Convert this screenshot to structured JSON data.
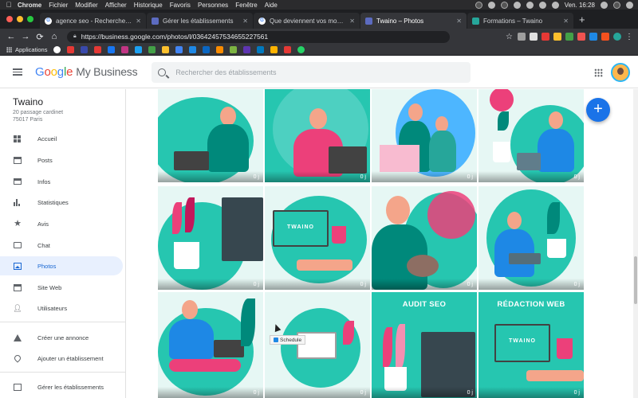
{
  "menubar": {
    "app": "Chrome",
    "items": [
      "Fichier",
      "Modifier",
      "Afficher",
      "Historique",
      "Favoris",
      "Personnes",
      "Fenêtre",
      "Aide"
    ],
    "clock": "Ven. 16:28"
  },
  "tabs": [
    {
      "title": "agence seo - Recherche Google",
      "favicon": "google-icon"
    },
    {
      "title": "Gérer les établissements",
      "favicon": "gmb-icon"
    },
    {
      "title": "Que deviennent vos modificatio",
      "favicon": "google-icon"
    },
    {
      "title": "Twaino – Photos",
      "favicon": "gmb-icon",
      "active": true
    },
    {
      "title": "Formations – Twaino",
      "favicon": "twaino-icon"
    }
  ],
  "toolbar": {
    "url": "https://business.google.com/photos/l/03642457534655227561"
  },
  "bookmarks": {
    "apps_label": "Applications"
  },
  "header": {
    "product": "My Business",
    "search_placeholder": "Rechercher des établissements"
  },
  "business": {
    "name": "Twaino",
    "address_line1": "20 passage cardinet",
    "address_line2": "75017 Paris"
  },
  "nav": [
    {
      "label": "Accueil",
      "icon": "dashboard-icon"
    },
    {
      "label": "Posts",
      "icon": "posts-icon"
    },
    {
      "label": "Infos",
      "icon": "store-icon"
    },
    {
      "label": "Statistiques",
      "icon": "stats-icon"
    },
    {
      "label": "Avis",
      "icon": "star-icon"
    },
    {
      "label": "Chat",
      "icon": "chat-icon"
    },
    {
      "label": "Photos",
      "icon": "photo-icon",
      "active": true
    },
    {
      "label": "Site Web",
      "icon": "web-icon"
    },
    {
      "label": "Utilisateurs",
      "icon": "add-user-icon"
    },
    {
      "label": "Créer une annonce",
      "icon": "google-ads-icon"
    },
    {
      "label": "Ajouter un établissement",
      "icon": "location-pin-icon"
    },
    {
      "label": "Gérer les établissements",
      "icon": "manage-icon"
    }
  ],
  "photos": {
    "count_label": "0 j",
    "captions": {
      "audit": "AUDIT SEO",
      "redaction": "RÉDACTION WEB"
    },
    "laptop_brand": "TWAINO"
  },
  "tooltip": "Schedule",
  "colors": {
    "accent": "#1a73e8",
    "teal": "#26c6b0",
    "pink": "#ec407a"
  }
}
